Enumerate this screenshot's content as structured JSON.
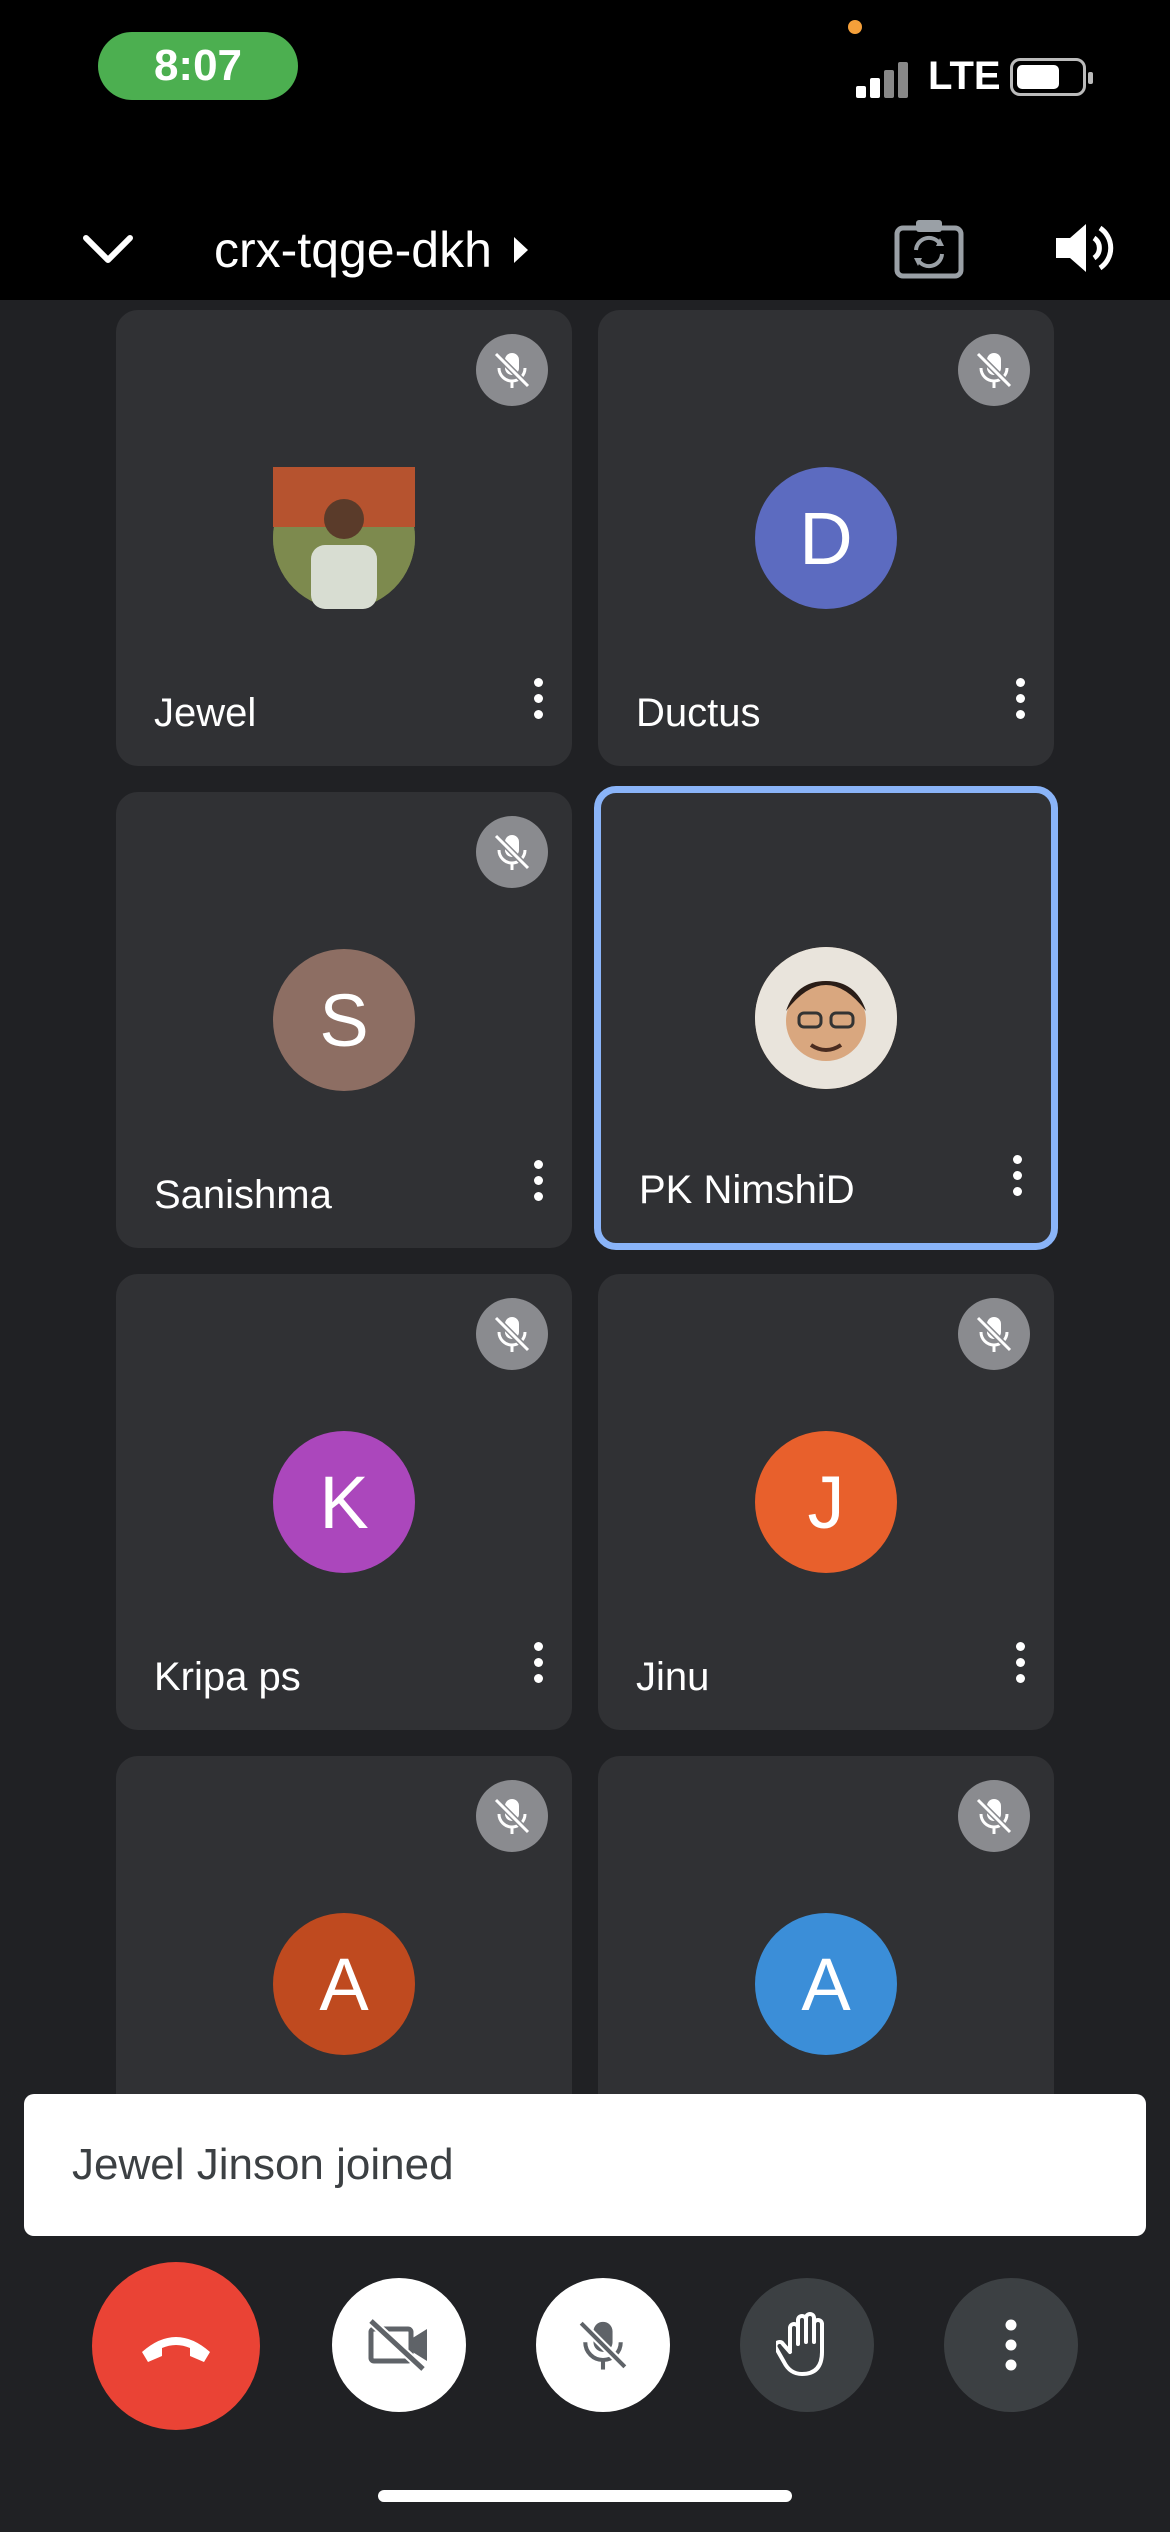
{
  "status_bar": {
    "time": "8:07",
    "network": "LTE"
  },
  "meeting": {
    "code": "crx-tqge-dkh"
  },
  "icons": {
    "collapse": "chevron-down-icon",
    "camera_switch": "camera-switch-icon",
    "speaker": "speaker-icon",
    "mic_off": "mic-off-icon",
    "more": "more-vert-icon"
  },
  "participants": [
    {
      "name": "Jewel",
      "initial": "",
      "avatar_type": "photo",
      "avatar_color": "#6b7d4a",
      "muted": true,
      "active": false
    },
    {
      "name": "Ductus",
      "initial": "D",
      "avatar_type": "initial",
      "avatar_color": "#5c6bc0",
      "muted": true,
      "active": false
    },
    {
      "name": "Sanishma",
      "initial": "S",
      "avatar_type": "initial",
      "avatar_color": "#8d6e63",
      "muted": true,
      "active": false
    },
    {
      "name": "PK NimshiD",
      "initial": "",
      "avatar_type": "photo",
      "avatar_color": "#c8a98a",
      "muted": false,
      "active": true
    },
    {
      "name": "Kripa ps",
      "initial": "K",
      "avatar_type": "initial",
      "avatar_color": "#ab47bc",
      "muted": true,
      "active": false
    },
    {
      "name": "Jinu",
      "initial": "J",
      "avatar_type": "initial",
      "avatar_color": "#e8602c",
      "muted": true,
      "active": false
    },
    {
      "name": "",
      "initial": "A",
      "avatar_type": "initial",
      "avatar_color": "#bf4a1f",
      "muted": true,
      "active": false
    },
    {
      "name": "",
      "initial": "A",
      "avatar_type": "initial",
      "avatar_color": "#3b8ed8",
      "muted": true,
      "active": false
    }
  ],
  "toast": {
    "message": "Jewel Jinson joined"
  },
  "controls": {
    "end_call_color": "#ea4335",
    "items": [
      "end-call-icon",
      "video-off-icon",
      "mic-off-icon",
      "raise-hand-icon",
      "more-vert-icon"
    ]
  },
  "colors": {
    "background": "#202124",
    "tile": "#303134",
    "active_border": "#8ab4f8",
    "toast_text": "#3c4043"
  }
}
